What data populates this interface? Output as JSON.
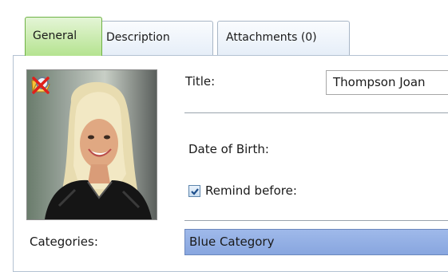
{
  "tabs": [
    {
      "label": "General",
      "active": true
    },
    {
      "label": "Description",
      "active": false
    },
    {
      "label": "Attachments (0)",
      "active": false
    }
  ],
  "photo": {
    "toolbar": [
      "open-folder-icon",
      "zoom-icon",
      "delete-icon"
    ]
  },
  "fields": {
    "title_label": "Title:",
    "title_value": "Thompson Joan",
    "dob_label": "Date of Birth:",
    "remind_label": "Remind before:",
    "remind_checked": true,
    "categories_label": "Categories:",
    "categories_value": "Blue Category"
  },
  "colors": {
    "active_tab": "#b5e390",
    "category_fill": "#88a6df",
    "delete_icon": "#e0201a"
  }
}
